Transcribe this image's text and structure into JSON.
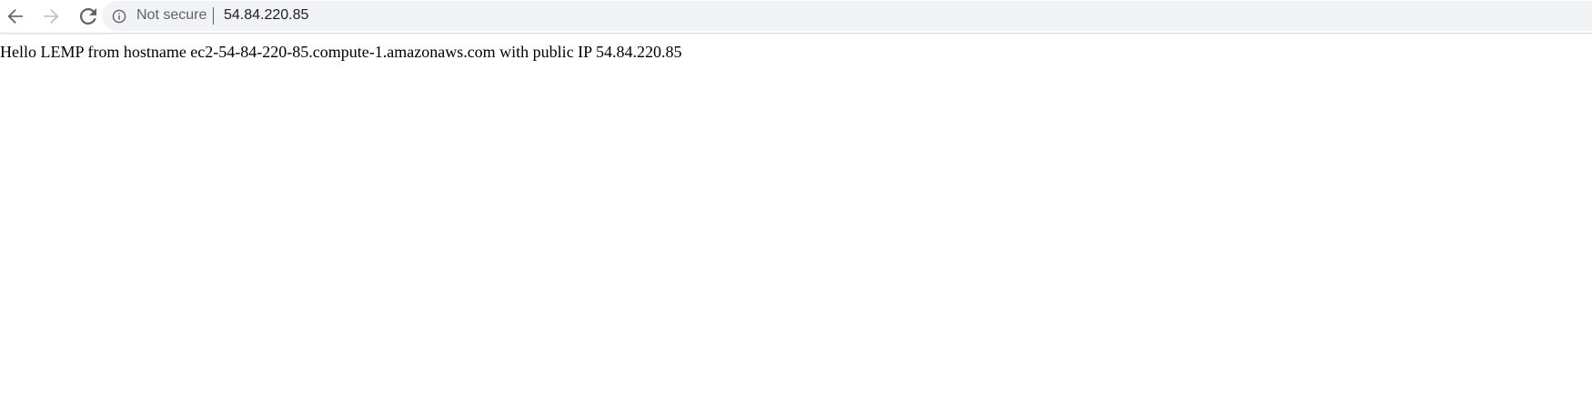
{
  "browser": {
    "nav": {
      "back_icon": "arrow-left-icon",
      "forward_icon": "arrow-right-icon",
      "reload_icon": "reload-icon"
    },
    "omnibox": {
      "info_icon": "info-circle-icon",
      "security_label": "Not secure",
      "url": "54.84.220.85"
    }
  },
  "page": {
    "body_text": "Hello LEMP from hostname ec2-54-84-220-85.compute-1.amazonaws.com with public IP 54.84.220.85"
  },
  "colors": {
    "toolbar_bg": "#ffffff",
    "omnibox_bg": "#f1f3f4",
    "icon_active": "#5f6368",
    "icon_disabled": "#bdc1c6",
    "url_text": "#202124",
    "page_text": "#000000"
  }
}
